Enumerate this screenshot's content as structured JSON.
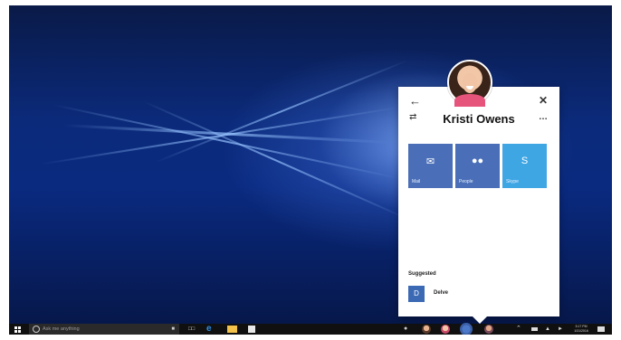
{
  "flyout": {
    "contact_name": "Kristi Owens",
    "tiles": [
      {
        "label": "Mail",
        "icon": "mail-icon",
        "color": "#4a6fb8"
      },
      {
        "label": "People",
        "icon": "people-icon",
        "color": "#4a6fb8"
      },
      {
        "label": "Skype",
        "icon": "skype-icon",
        "color": "#3fa6e4"
      }
    ],
    "suggested_heading": "Suggested",
    "suggested_apps": [
      {
        "label": "Delve",
        "icon": "delve-icon"
      }
    ]
  },
  "taskbar": {
    "search_placeholder": "Ask me anything",
    "clock_time": "3:17 PM",
    "clock_date": "1/31/2016"
  },
  "colors": {
    "taskbar": "#101010",
    "tile_blue": "#4a6fb8",
    "skype_blue": "#3fa6e4"
  }
}
